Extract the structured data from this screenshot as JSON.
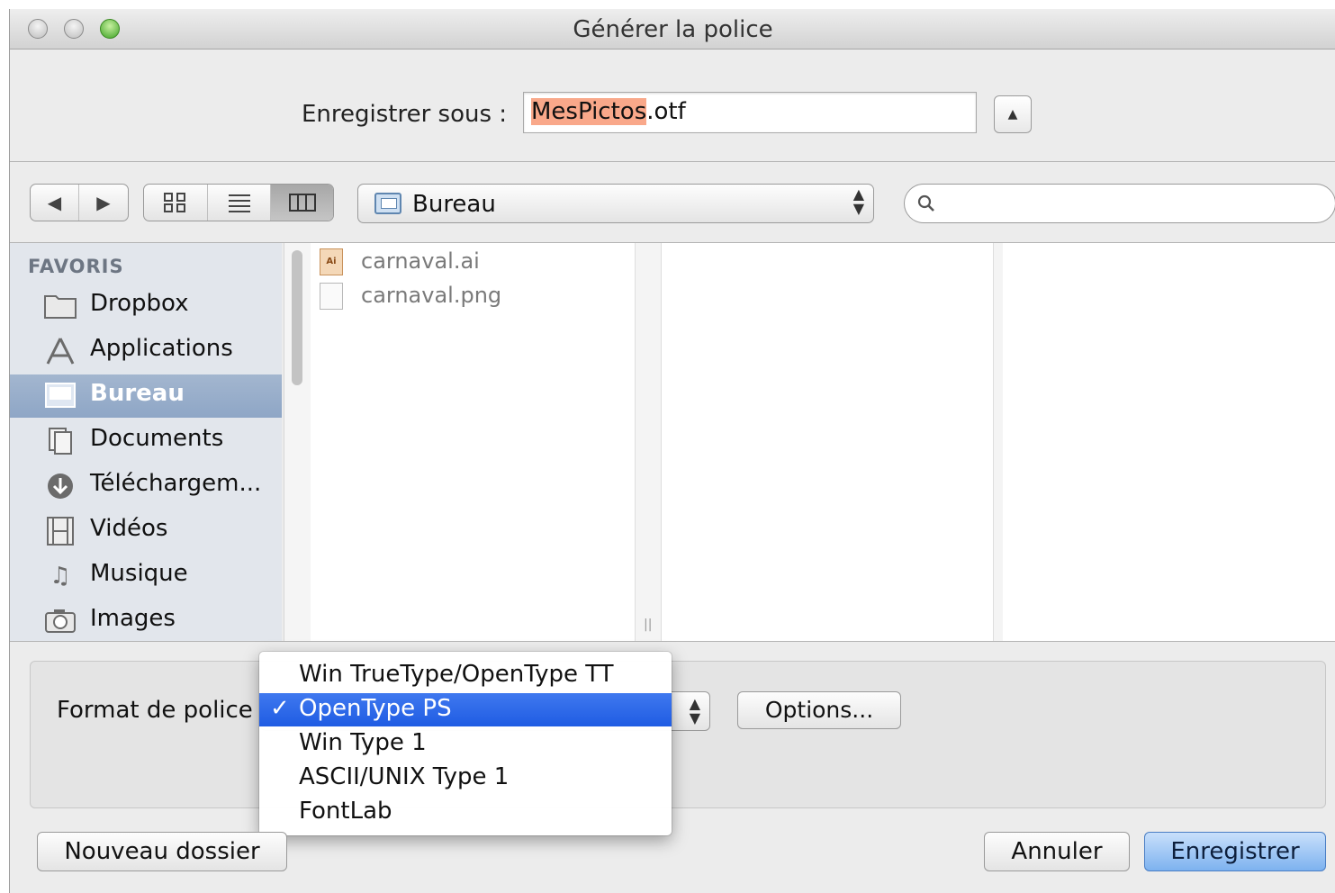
{
  "window": {
    "title": "Générer la police"
  },
  "save_as": {
    "label": "Enregistrer sous :",
    "filename_selected": "MesPictos",
    "filename_rest": ".otf"
  },
  "toolbar": {
    "back_icon": "back-arrow-icon",
    "forward_icon": "forward-arrow-icon",
    "view_icons": [
      "icon-view-icon",
      "list-view-icon",
      "column-view-icon"
    ],
    "active_view": "column-view",
    "location": "Bureau",
    "search_placeholder": ""
  },
  "sidebar": {
    "header": "FAVORIS",
    "items": [
      {
        "label": "Dropbox",
        "icon": "folder-icon"
      },
      {
        "label": "Applications",
        "icon": "applications-icon"
      },
      {
        "label": "Bureau",
        "icon": "desktop-icon",
        "selected": true
      },
      {
        "label": "Documents",
        "icon": "documents-icon"
      },
      {
        "label": "Téléchargem...",
        "icon": "downloads-icon"
      },
      {
        "label": "Vidéos",
        "icon": "movies-icon"
      },
      {
        "label": "Musique",
        "icon": "music-icon"
      },
      {
        "label": "Images",
        "icon": "camera-icon"
      }
    ]
  },
  "files": [
    {
      "name": "carnaval.ai",
      "icon_text": "Ai"
    },
    {
      "name": "carnaval.png",
      "icon_text": ""
    }
  ],
  "format": {
    "label": "Format de police",
    "options": [
      {
        "label": "Win TrueType/OpenType TT"
      },
      {
        "label": "OpenType PS",
        "selected": true
      },
      {
        "label": "Win Type 1"
      },
      {
        "label": "ASCII/UNIX Type 1"
      },
      {
        "label": "FontLab"
      }
    ],
    "checkmark": "✓",
    "options_button": "Options..."
  },
  "buttons": {
    "new_folder": "Nouveau dossier",
    "cancel": "Annuler",
    "save": "Enregistrer"
  }
}
